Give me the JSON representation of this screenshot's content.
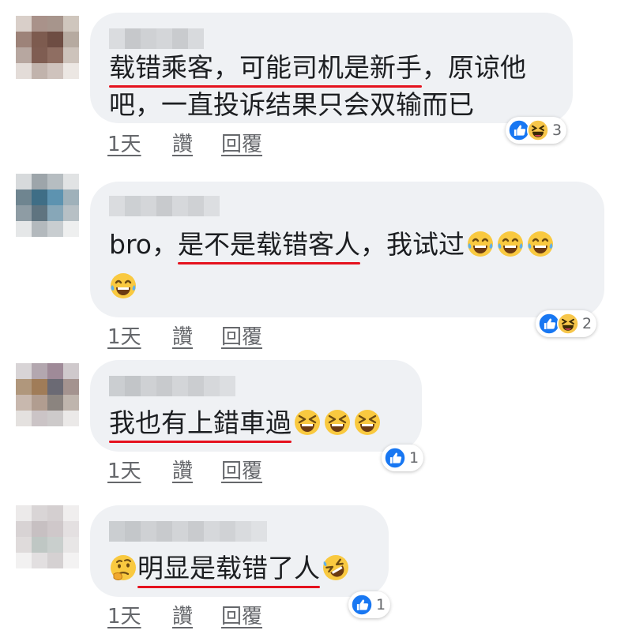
{
  "comments": [
    {
      "lines": [
        [
          "载错乘客，可能司机是新手",
          "，原谅他"
        ],
        [
          "吧，一直投诉结果只会双输而已"
        ]
      ],
      "time": "1天",
      "like": "讚",
      "reply": "回覆",
      "reactions_count": "3",
      "reactions": [
        "like-icon",
        "haha-icon"
      ]
    },
    {
      "prefix": "bro，",
      "underlined": "是不是载错客人",
      "suffix": "，我试过",
      "time": "1天",
      "like": "讚",
      "reply": "回覆",
      "reactions_count": "2",
      "reactions": [
        "like-icon",
        "haha-icon"
      ]
    },
    {
      "underlined": "我也有上錯車過",
      "time": "1天",
      "like": "讚",
      "reply": "回覆",
      "reactions_count": "1",
      "reactions": [
        "like-icon"
      ]
    },
    {
      "underlined": "明显是载错了人",
      "time": "1天",
      "like": "讚",
      "reply": "回覆",
      "reactions_count": "1",
      "reactions": [
        "like-icon"
      ]
    }
  ],
  "colors": {
    "bubble": "#eff1f4",
    "underline": "#e5121e",
    "like_blue": "#1877f2",
    "meta": "#65676b"
  }
}
